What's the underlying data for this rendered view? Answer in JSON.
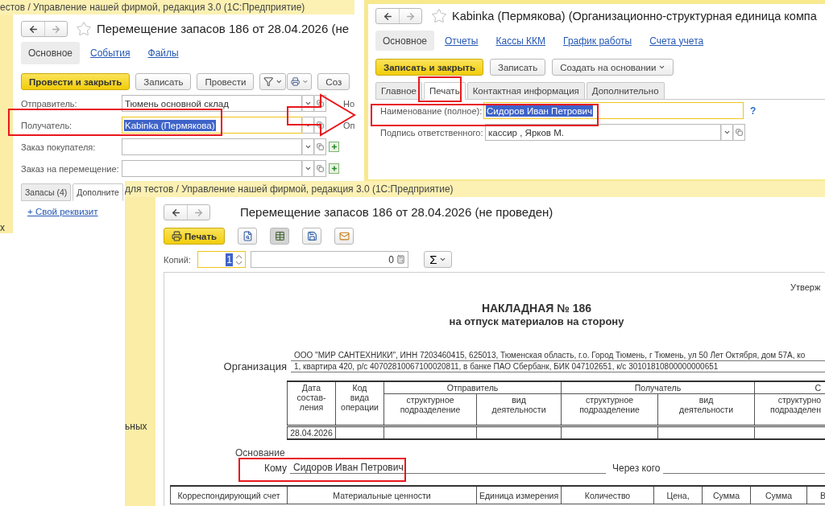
{
  "order_window": {
    "title": "естов / Управление нашей фирмой, редакция 3.0  (1С:Предприятие)",
    "side_fragment": "х",
    "heading": "Перемещение запасов 186 от 28.04.2026 (не",
    "sections": [
      {
        "label": "Основное",
        "selected": true
      },
      {
        "label": "События",
        "selected": false
      },
      {
        "label": "Файлы",
        "selected": false
      }
    ],
    "buttons": [
      {
        "kind": "primary",
        "label": "Провести и закрыть"
      },
      {
        "kind": "plain",
        "label": "Записать"
      },
      {
        "kind": "plain",
        "label": "Провести"
      },
      {
        "kind": "filter"
      },
      {
        "kind": "print"
      },
      {
        "kind": "plain",
        "label": "Соз"
      }
    ],
    "fields": [
      {
        "label": "Отправитель:",
        "value": "Тюмень основной склад",
        "focused": false,
        "has_add": false,
        "side_label": "Но"
      },
      {
        "label": "Получатель:",
        "value": "Kabinka (Пермякова)",
        "focused": true,
        "has_add": false,
        "side_label": "Оп"
      },
      {
        "label": "Заказ покупателя:",
        "focused": false,
        "has_add": true
      },
      {
        "label": "Заказ на перемещение:",
        "focused": false,
        "has_add": true
      }
    ],
    "tabs": [
      {
        "label": "Запасы (4)",
        "selected": false
      },
      {
        "label": "Дополните",
        "selected": true
      }
    ],
    "link": "+ Свой реквизит"
  },
  "unit_window": {
    "heading": "Kabinka (Пермякова) (Организационно-структурная единица компа",
    "sections": [
      {
        "label": "Основное",
        "selected": true
      },
      {
        "label": "Отчеты",
        "selected": false
      },
      {
        "label": "Кассы ККМ",
        "selected": false
      },
      {
        "label": "График работы",
        "selected": false
      },
      {
        "label": "Счета учета",
        "selected": false
      }
    ],
    "buttons": [
      {
        "kind": "primary",
        "label": "Записать и закрыть"
      },
      {
        "kind": "plain",
        "label": "Записать"
      },
      {
        "kind": "menu",
        "label": "Создать на основании"
      }
    ],
    "tabs": [
      {
        "label": "Главное",
        "selected": false
      },
      {
        "label": "Печать",
        "selected": true
      },
      {
        "label": "Контактная информация",
        "selected": false
      },
      {
        "label": "Дополнительно",
        "selected": false
      }
    ],
    "fields": [
      {
        "kind": "text",
        "label": "Наименование (полное):",
        "value": "Сидоров Иван Петрович",
        "focused": true,
        "help": "?"
      },
      {
        "kind": "ref",
        "label": "Подпись ответственного:",
        "value": "кассир , Ярков М.",
        "focused": false
      }
    ]
  },
  "print_window": {
    "title": "для тестов / Управление нашей фирмой, редакция 3.0  (1С:Предприятие)",
    "side_fragment": "ьных",
    "heading": "Перемещение запасов 186 от 28.04.2026 (не проведен)",
    "print_button": "Печать",
    "tools": [
      {
        "kind": "preview",
        "pressed": false
      },
      {
        "kind": "grid",
        "pressed": true
      },
      {
        "kind": "save",
        "pressed": false
      },
      {
        "kind": "mail",
        "pressed": false
      }
    ],
    "copies_label": "Копий:",
    "copies": "1",
    "total": "0",
    "sum_button": "Σ",
    "document": {
      "approve": "Утверж",
      "title": "НАКЛАДНАЯ № 186",
      "subtitle": "на отпуск материалов на сторону",
      "org_label": "Организация",
      "org_lines": [
        "ООО \"МИР САНТЕХНИКИ\",  ИНН 7203460415,  625013, Тюменская область, г.о. Город Тюмень, г Тюмень, ул 50 Лет Октября, дом 57А, ко",
        "1, квартира 420,  р/с 40702810067100020811,  в банке ПАО Сбербанк,  БИК 047102651,  к/с 30101810800000000651"
      ],
      "date_header": "Дата\nсостав-\nления",
      "code_header": "Код\nвида\nоперации",
      "groups": [
        {
          "label": "Отправитель",
          "sub": [
            "структурное\nподразделение",
            "вид\nдеятельности"
          ]
        },
        {
          "label": "Получатель",
          "sub": [
            "структурное\nподразделение",
            "вид\nдеятельности"
          ]
        },
        {
          "label": "С",
          "sub": [
            "структурно\nподразделен"
          ]
        }
      ],
      "date": "28.04.2026",
      "basis_label": "Основание",
      "to_label": "Кому",
      "to_value": "Сидоров Иван Петрович",
      "via_label": "Через кого",
      "item_columns": [
        "Корреспондирующий счет",
        "Материальные ценности",
        "Единица измерения",
        "Количество",
        "Цена,",
        "Сумма",
        "Сумма",
        "В"
      ]
    }
  }
}
